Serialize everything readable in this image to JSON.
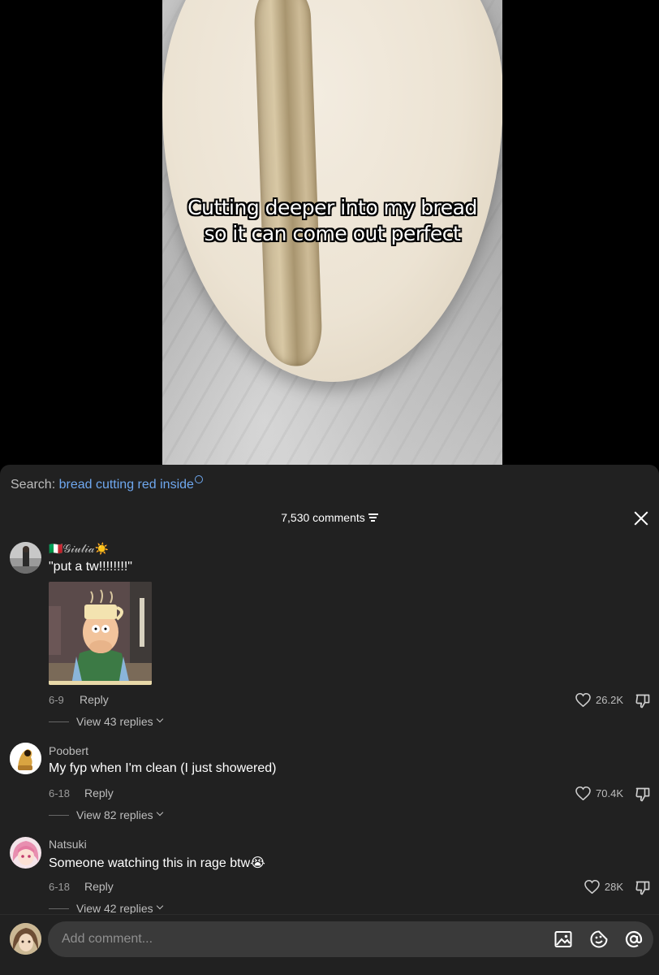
{
  "video": {
    "caption_line1": "Cutting deeper into my bread",
    "caption_line2": "so it can come out perfect"
  },
  "search": {
    "prefix": "Search:",
    "query": "bread cutting red inside"
  },
  "comments_header": {
    "count_label": "7,530 comments"
  },
  "comments": [
    {
      "username": "🇮🇹𝒢𝒾𝓊𝓁𝒾𝒶☀️",
      "text": "\"put a tw!!!!!!!!\"",
      "date": "6-9",
      "reply_label": "Reply",
      "likes": "26.2K",
      "view_replies": "View 43 replies",
      "has_gif": true
    },
    {
      "username": "Poobert",
      "text": "My fyp when I'm clean (I just showered)",
      "date": "6-18",
      "reply_label": "Reply",
      "likes": "70.4K",
      "view_replies": "View 82 replies"
    },
    {
      "username": "Natsuki",
      "text": "Someone watching this in rage btw😭",
      "date": "6-18",
      "reply_label": "Reply",
      "likes": "28K",
      "view_replies": "View 42 replies"
    }
  ],
  "input": {
    "placeholder": "Add comment..."
  },
  "colors": {
    "panel_bg": "#212121",
    "search_link": "#6fa8ef",
    "input_bg": "#3a3a3a"
  },
  "icons": [
    "sort-icon",
    "close-icon",
    "heart-icon",
    "dislike-icon",
    "chevron-down-icon",
    "image-icon",
    "emoji-icon",
    "mention-icon"
  ]
}
